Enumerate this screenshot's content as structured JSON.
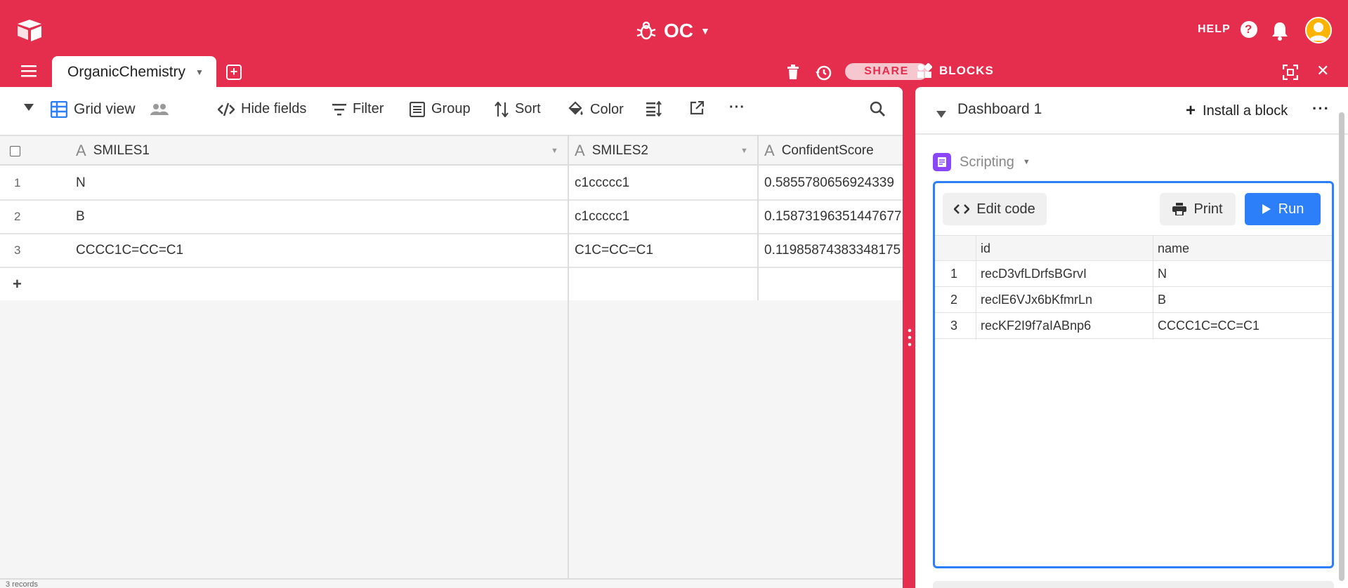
{
  "app": {
    "base_name": "OC",
    "help_label": "HELP",
    "accent_color": "#e52e4d"
  },
  "tabs": {
    "active_table": "OrganicChemistry"
  },
  "header_actions": {
    "share_label": "SHARE",
    "blocks_label": "BLOCKS"
  },
  "toolbar": {
    "view_name": "Grid view",
    "hide_fields": "Hide fields",
    "filter": "Filter",
    "group": "Group",
    "sort": "Sort",
    "color": "Color",
    "more": "···"
  },
  "grid": {
    "columns": [
      "SMILES1",
      "SMILES2",
      "ConfidentScore"
    ],
    "rows": [
      {
        "num": "1",
        "smiles1": "N",
        "smiles2": "c1ccccc1",
        "score": "0.5855780656924339"
      },
      {
        "num": "2",
        "smiles1": "B",
        "smiles2": "c1ccccc1",
        "score": "0.15873196351447677"
      },
      {
        "num": "3",
        "smiles1": "CCCC1C=CC=C1",
        "smiles2": "C1C=CC=C1",
        "score": "0.11985874383348175"
      }
    ],
    "add_row": "+",
    "footer_text": "3 records"
  },
  "dashboard": {
    "title": "Dashboard 1",
    "install_label": "Install a block",
    "more": "···",
    "block_name": "Scripting",
    "edit_code": "Edit code",
    "print": "Print",
    "run": "Run",
    "output_table": {
      "columns": [
        "id",
        "name"
      ],
      "rows": [
        {
          "num": "1",
          "id": "recD3vfLDrfsBGrvI",
          "name": "N"
        },
        {
          "num": "2",
          "id": "reclE6VJx6bKfmrLn",
          "name": "B"
        },
        {
          "num": "3",
          "id": "recKF2I9f7aIABnp6",
          "name": "CCCC1C=CC=C1"
        }
      ]
    }
  }
}
